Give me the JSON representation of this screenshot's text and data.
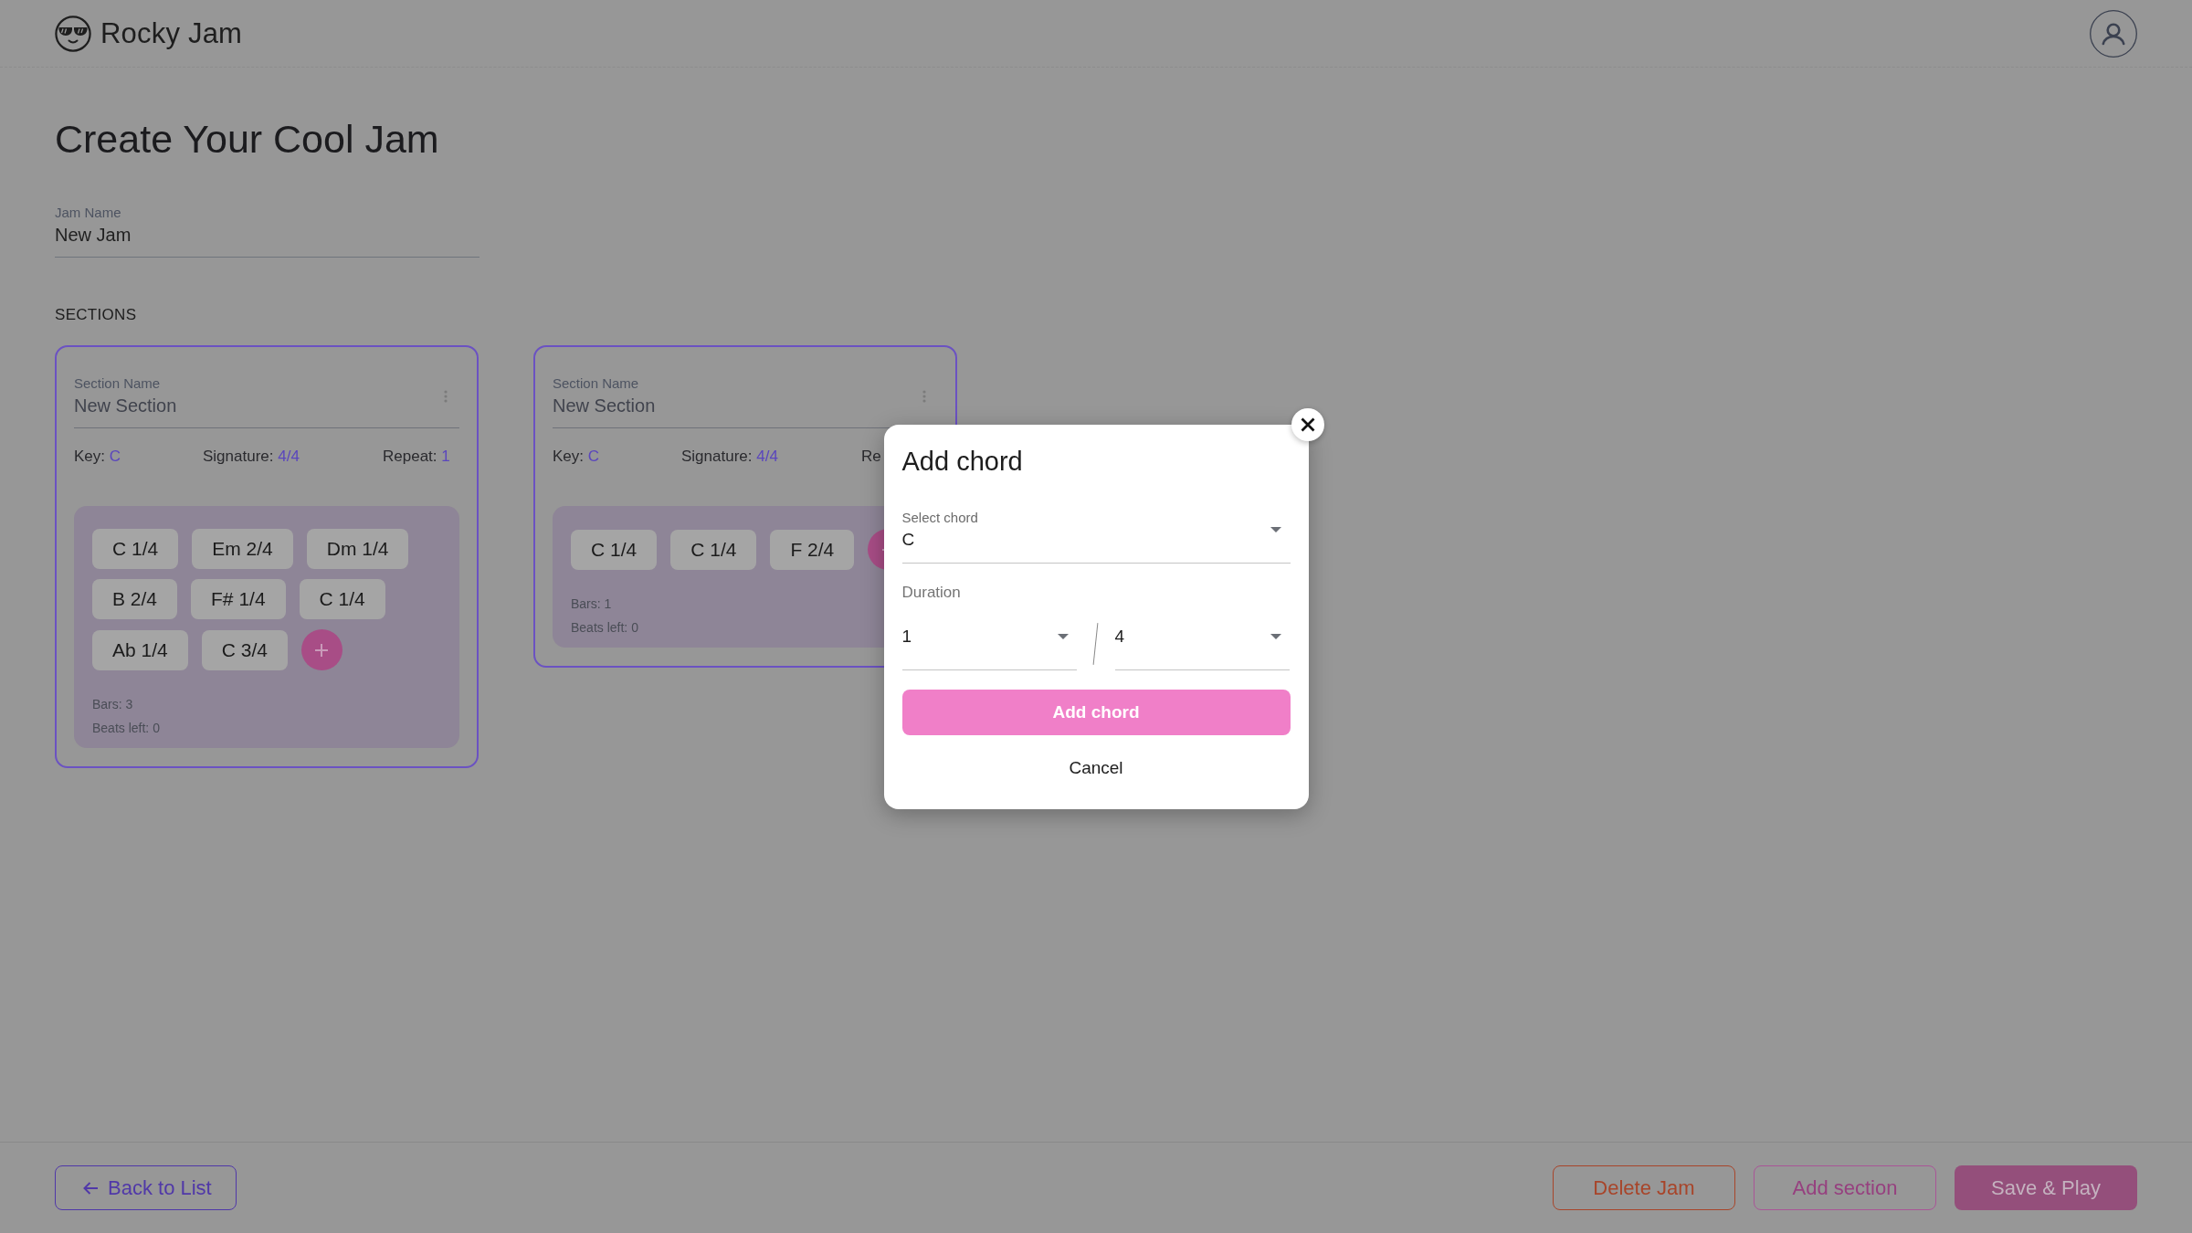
{
  "header": {
    "logo_text": "Rocky Jam"
  },
  "title": "Create Your Cool Jam",
  "jam_name": {
    "label": "Jam Name",
    "value": "New Jam"
  },
  "sections_heading": "SECTIONS",
  "sections": [
    {
      "name_field": {
        "label": "Section Name",
        "value": "New Section"
      },
      "meta": [
        {
          "label": "Key:",
          "value": "C"
        },
        {
          "label": "Signature:",
          "value": "4/4"
        },
        {
          "label": "Repeat:",
          "value": "1"
        }
      ],
      "chords": [
        "C 1/4",
        "Em 2/4",
        "Dm 1/4",
        "B 2/4",
        "F# 1/4",
        "C 1/4",
        "Ab 1/4",
        "C 3/4"
      ],
      "bars": "Bars: 3",
      "beats_left": "Beats left: 0"
    },
    {
      "name_field": {
        "label": "Section Name",
        "value": "New Section"
      },
      "meta": [
        {
          "label": "Key:",
          "value": "C"
        },
        {
          "label": "Signature:",
          "value": "4/4"
        },
        {
          "label": "Re"
        }
      ],
      "chords": [
        "C 1/4",
        "C 1/4",
        "F 2/4"
      ],
      "bars": "Bars: 1",
      "beats_left": "Beats left: 0"
    }
  ],
  "dialog": {
    "title": "Add chord",
    "chord_select": {
      "label": "Select chord",
      "value": "C"
    },
    "duration": {
      "label": "Duration",
      "numerator": "1",
      "denominator": "4"
    },
    "submit": "Add chord",
    "cancel": "Cancel"
  },
  "footer": {
    "buttons": [
      {
        "kind": "back",
        "label": "Back to List"
      },
      {
        "kind": "danger",
        "label": "Delete Jam"
      },
      {
        "kind": "secondary",
        "label": "Add section"
      },
      {
        "kind": "primary",
        "label": "Save & Play"
      }
    ]
  }
}
